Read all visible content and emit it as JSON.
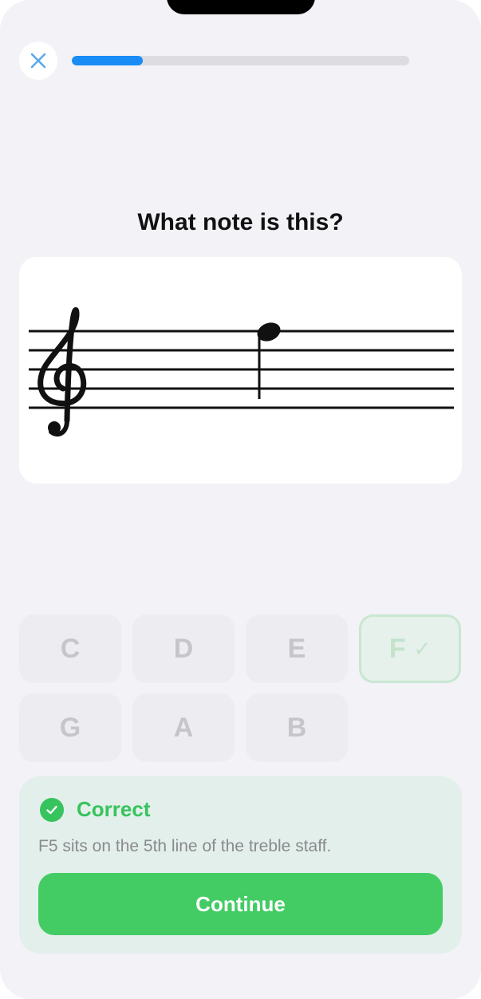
{
  "progress": {
    "fraction": 0.21
  },
  "question": {
    "title": "What note is this?"
  },
  "staff": {
    "clef": "treble",
    "note": "F5",
    "note_type": "quarter"
  },
  "answers": [
    {
      "label": "C",
      "state": "disabled"
    },
    {
      "label": "D",
      "state": "disabled"
    },
    {
      "label": "E",
      "state": "disabled"
    },
    {
      "label": "F",
      "state": "correct",
      "mark": "✓"
    },
    {
      "label": "G",
      "state": "disabled"
    },
    {
      "label": "A",
      "state": "disabled"
    },
    {
      "label": "B",
      "state": "disabled"
    }
  ],
  "feedback": {
    "title": "Correct",
    "message": "F5 sits on the 5th line of the treble staff.",
    "continue_label": "Continue"
  },
  "colors": {
    "accent": "#1a8cf5",
    "success": "#37c35d",
    "button": "#43cc64",
    "background": "#f2f2f7"
  },
  "icons": {
    "close": "close-icon",
    "clef": "treble-clef-icon",
    "feedback": "check-circle-icon"
  }
}
